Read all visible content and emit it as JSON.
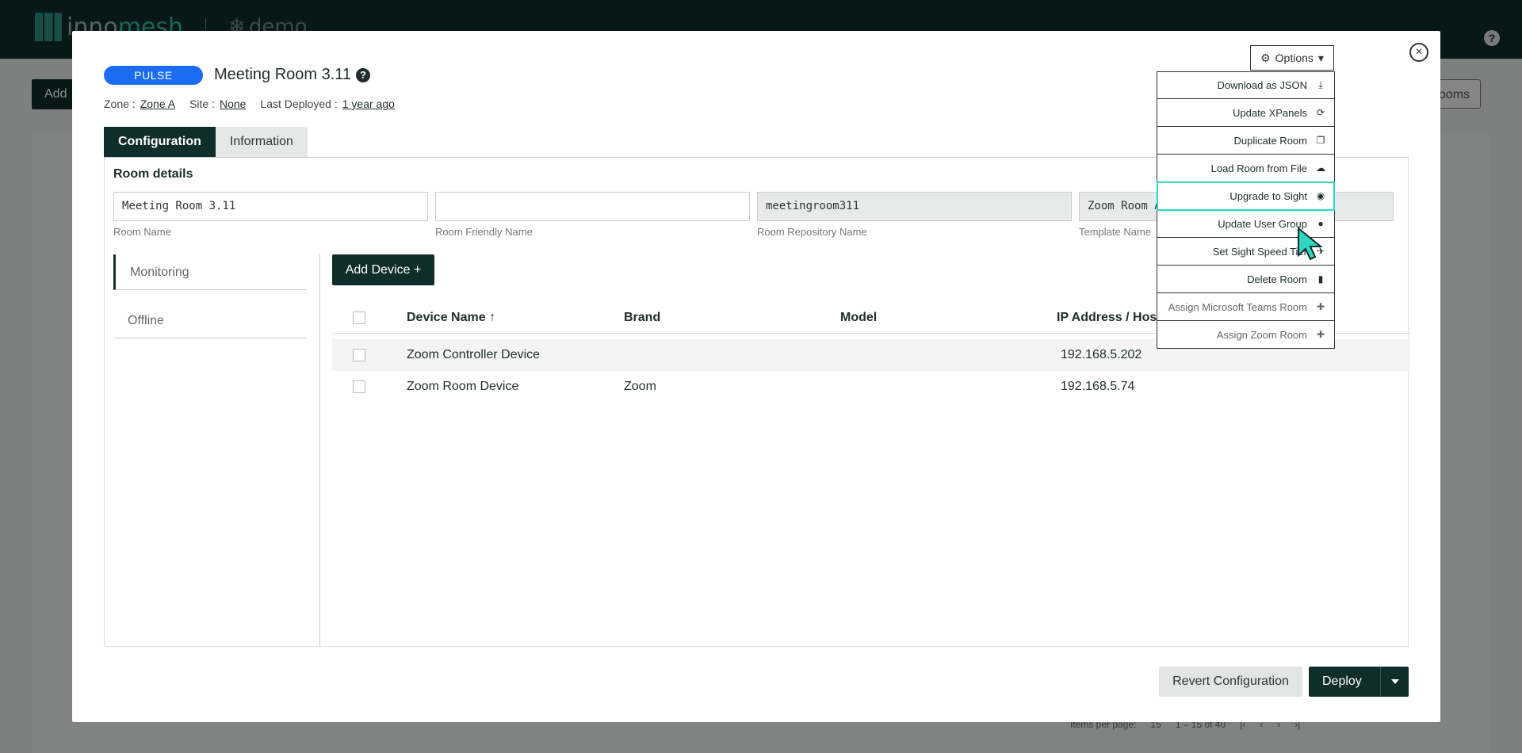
{
  "app": {
    "brand_a": "inno",
    "brand_b": "mesh",
    "tenant": "demo",
    "help": "?"
  },
  "background": {
    "add_label": "Add",
    "rooms_label": "ooms",
    "items_per_page_label": "Items per page:",
    "items_per_page": "15",
    "range": "1 – 15 of 40"
  },
  "modal": {
    "badge": "PULSE",
    "title": "Meeting Room 3.11",
    "help": "?",
    "close": "×",
    "meta": {
      "zone_label": "Zone :",
      "zone": "Zone A",
      "site_label": "Site :",
      "site": "None",
      "deployed_label": "Last Deployed :",
      "deployed": "1 year ago"
    },
    "tabs": [
      "Configuration",
      "Information"
    ],
    "room_details": {
      "title": "Room details",
      "fields": [
        {
          "value": "Meeting Room 3.11",
          "label": "Room Name"
        },
        {
          "value": "",
          "label": "Room Friendly Name"
        },
        {
          "value": "meetingroom311",
          "label": "Room Repository Name"
        },
        {
          "value": "Zoom Room Advanced",
          "label": "Template Name"
        }
      ]
    },
    "side": [
      "Monitoring",
      "Offline"
    ],
    "add_device": "Add Device +",
    "columns": {
      "name": "Device Name ↑",
      "brand": "Brand",
      "model": "Model",
      "ip": "IP Address / Hostname"
    },
    "rows": [
      {
        "name": "Zoom Controller Device",
        "brand": "",
        "model": "",
        "ip": "192.168.5.202"
      },
      {
        "name": "Zoom Room Device",
        "brand": "Zoom",
        "model": "",
        "ip": "192.168.5.74"
      }
    ],
    "options": {
      "label": "Options",
      "items": [
        {
          "label": "Download as JSON",
          "icon": "download-icon"
        },
        {
          "label": "Update XPanels",
          "icon": "refresh-icon"
        },
        {
          "label": "Duplicate Room",
          "icon": "copy-icon"
        },
        {
          "label": "Load Room from File",
          "icon": "cloud-upload-icon"
        },
        {
          "label": "Upgrade to Sight",
          "icon": "eye-icon"
        },
        {
          "label": "Update User Group",
          "icon": "user-icon"
        },
        {
          "label": "Set Sight Speed Tier",
          "icon": "plane-icon"
        },
        {
          "label": "Delete Room",
          "icon": "trash-icon"
        },
        {
          "label": "Assign Microsoft Teams Room",
          "icon": "user-plus-icon"
        },
        {
          "label": "Assign Zoom Room",
          "icon": "user-plus-icon"
        }
      ]
    },
    "revert": "Revert Configuration",
    "deploy": "Deploy"
  }
}
